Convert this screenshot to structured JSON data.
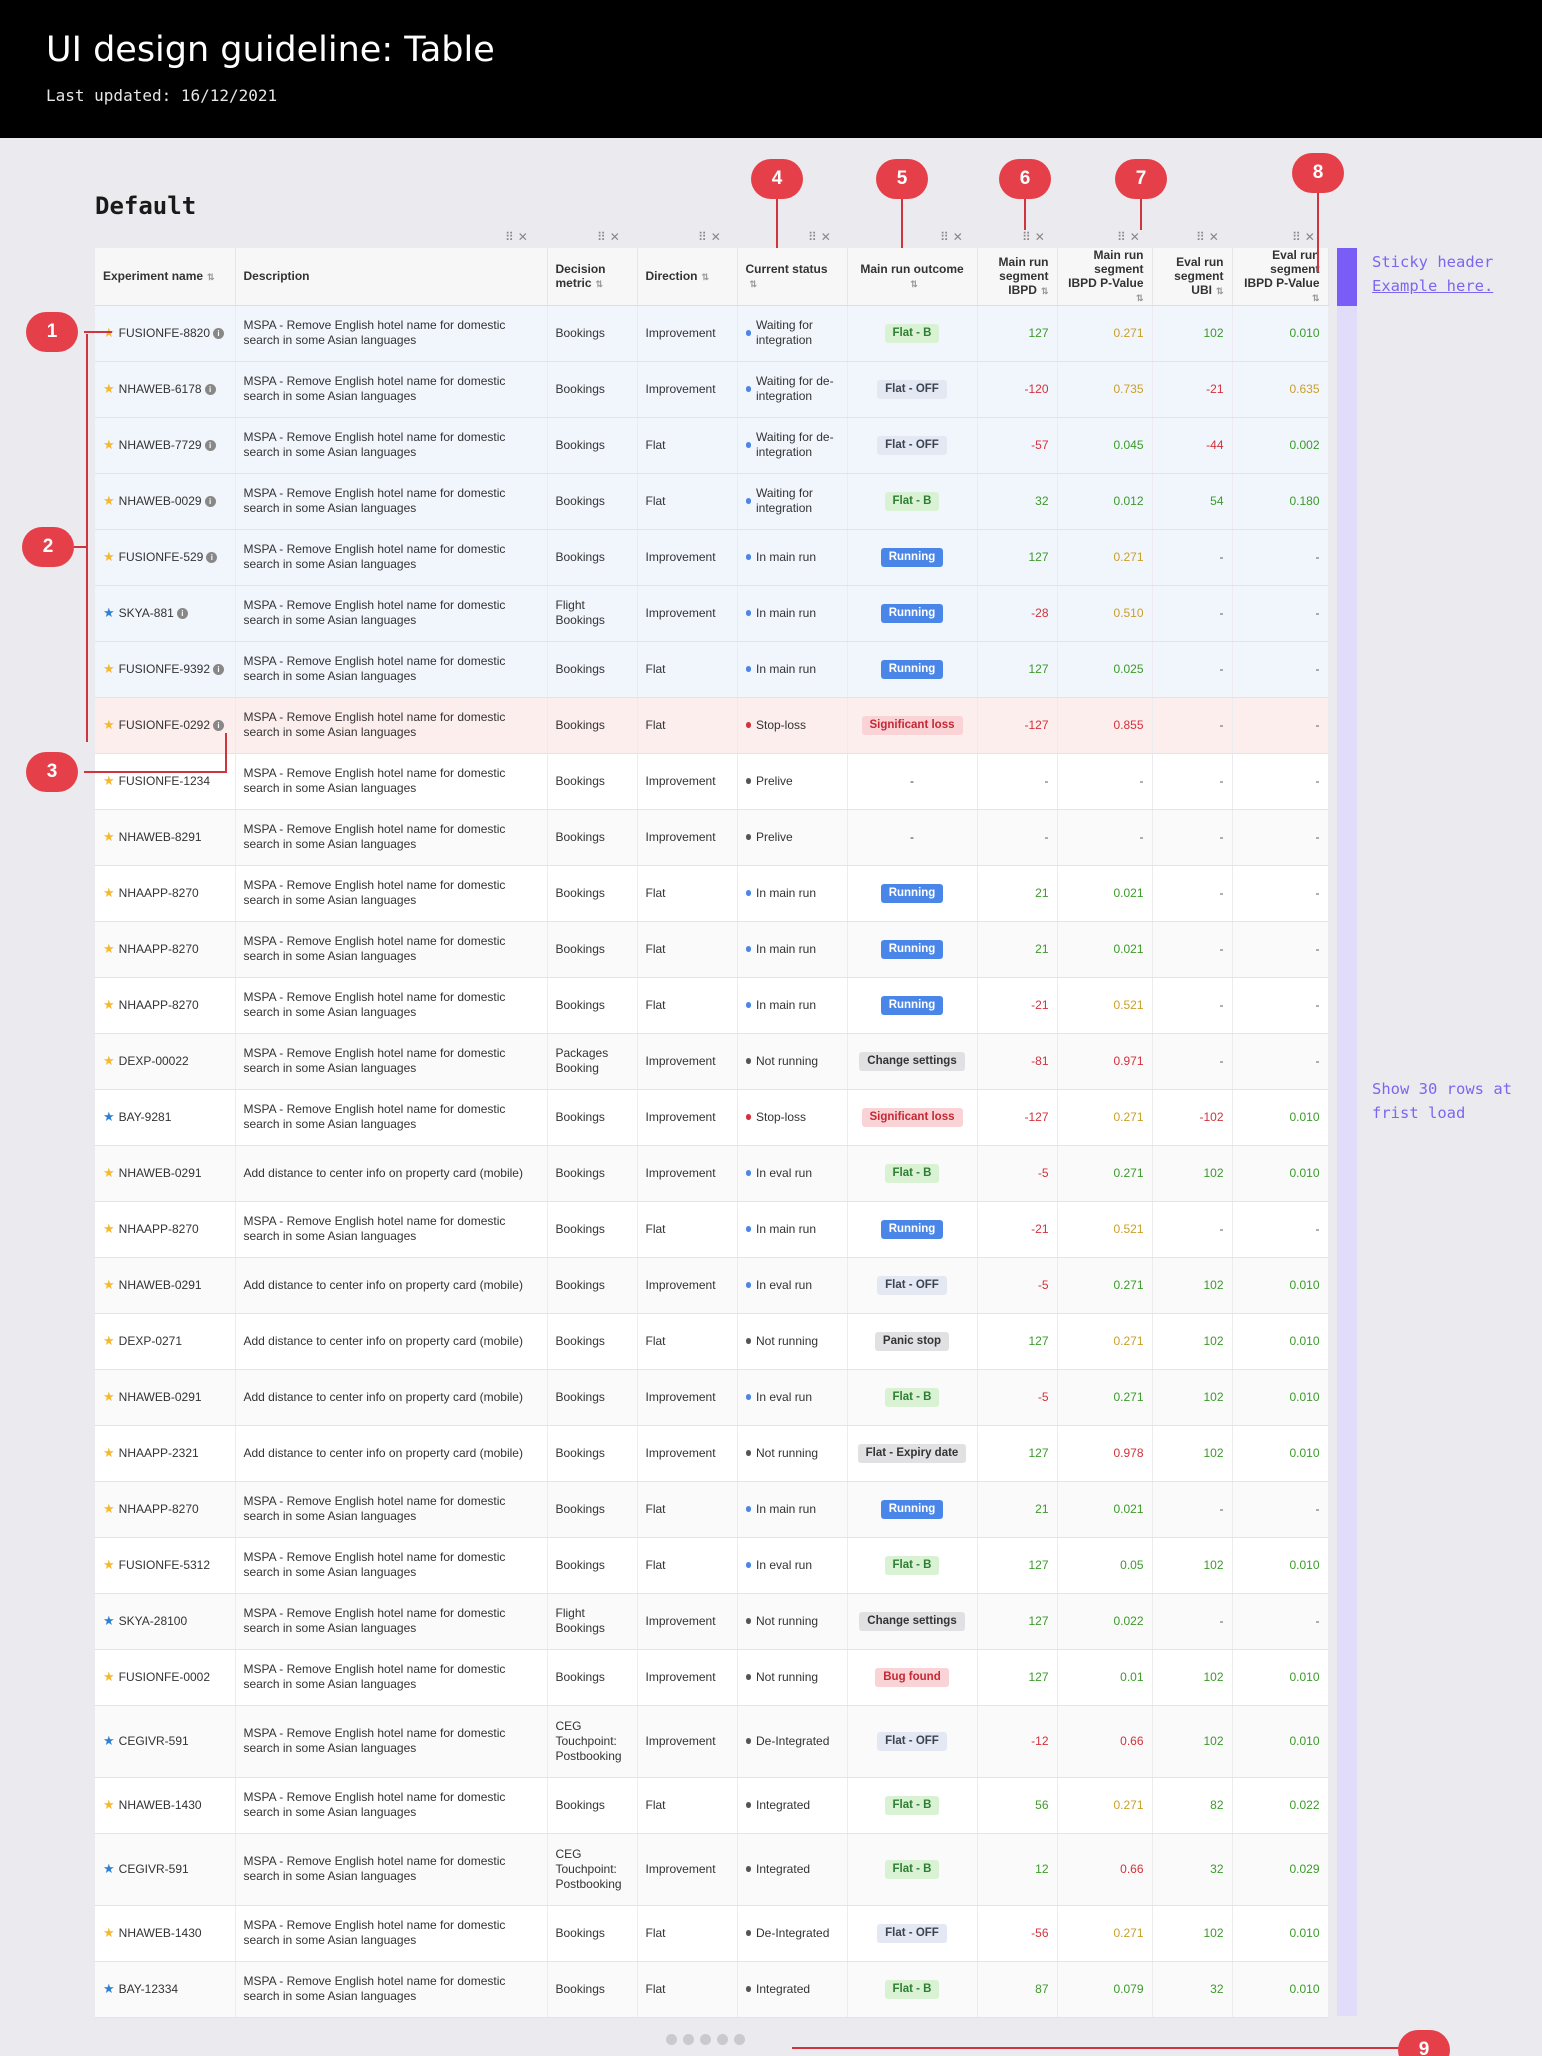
{
  "header": {
    "title": "UI design guideline: Table",
    "subtitle": "Last updated: 16/12/2021"
  },
  "section_title": "Default",
  "columns": [
    "Experiment name",
    "Description",
    "Decision metric",
    "Direction",
    "Current status",
    "Main run outcome",
    "Main run segment IBPD",
    "Main run segment IBPD P-Value",
    "Eval run segment UBI",
    "Eval run segment IBPD P-Value"
  ],
  "icons": {
    "star": "star-icon",
    "info": "info-icon",
    "sort": "sort-icon",
    "drag": "drag-handle-icon",
    "close": "close-icon"
  },
  "column_controls": {
    "drag": "⠿",
    "close": "✕"
  },
  "colors": {
    "star_yellow": "#f5b82e",
    "star_blue": "#2f7fd1",
    "positive": "#3c9a2a",
    "negative": "#d3313b",
    "neutral_amber": "#c99f2a",
    "dot_blue": "#4a86e8",
    "dot_red": "#d3313b",
    "dot_gray": "#555555",
    "accent": "#7a5cf6",
    "marker": "#e5404a"
  },
  "badge_styles": {
    "Flat - B": {
      "bg": "#d9f2d4",
      "fg": "#2e7d32"
    },
    "Flat - OFF": {
      "bg": "#e3e8f2",
      "fg": "#3b4352"
    },
    "Running": {
      "bg": "#4a86e8",
      "fg": "#ffffff"
    },
    "Significant loss": {
      "bg": "#f9d3d5",
      "fg": "#c62834"
    },
    "Change settings": {
      "bg": "#e1e1e4",
      "fg": "#333333"
    },
    "Panic stop": {
      "bg": "#e1e1e4",
      "fg": "#333333"
    },
    "Flat - Expiry date": {
      "bg": "#e1e1e4",
      "fg": "#333333"
    },
    "Bug found": {
      "bg": "#f9d3d5",
      "fg": "#c62834"
    }
  },
  "rows": [
    {
      "name": "FUSIONFE-8820",
      "star": "yellow",
      "info": true,
      "desc": "MSPA - Remove English hotel name for domestic search in some Asian languages",
      "metric": "Bookings",
      "direction": "Improvement",
      "status": "Waiting for integration",
      "dot": "blue",
      "outcome": "Flat - B",
      "ibpd": "127",
      "ibpd_c": "positive",
      "pval": "0.271",
      "pval_c": "neutral_amber",
      "ubi": "102",
      "ubi_c": "positive",
      "epval": "0.010",
      "epval_c": "positive",
      "bg": "band"
    },
    {
      "name": "NHAWEB-6178",
      "star": "yellow",
      "info": true,
      "desc": "MSPA - Remove English hotel name for domestic search in some Asian languages",
      "metric": "Bookings",
      "direction": "Improvement",
      "status": "Waiting for de-integration",
      "dot": "blue",
      "outcome": "Flat - OFF",
      "ibpd": "-120",
      "ibpd_c": "negative",
      "pval": "0.735",
      "pval_c": "neutral_amber",
      "ubi": "-21",
      "ubi_c": "negative",
      "epval": "0.635",
      "epval_c": "neutral_amber",
      "bg": "band"
    },
    {
      "name": "NHAWEB-7729",
      "star": "yellow",
      "info": true,
      "desc": "MSPA - Remove English hotel name for domestic search in some Asian languages",
      "metric": "Bookings",
      "direction": "Flat",
      "status": "Waiting for de-integration",
      "dot": "blue",
      "outcome": "Flat - OFF",
      "ibpd": "-57",
      "ibpd_c": "negative",
      "pval": "0.045",
      "pval_c": "positive",
      "ubi": "-44",
      "ubi_c": "negative",
      "epval": "0.002",
      "epval_c": "positive",
      "bg": "band"
    },
    {
      "name": "NHAWEB-0029",
      "star": "yellow",
      "info": true,
      "desc": "MSPA - Remove English hotel name for domestic search in some Asian languages",
      "metric": "Bookings",
      "direction": "Flat",
      "status": "Waiting for integration",
      "dot": "blue",
      "outcome": "Flat - B",
      "ibpd": "32",
      "ibpd_c": "positive",
      "pval": "0.012",
      "pval_c": "positive",
      "ubi": "54",
      "ubi_c": "positive",
      "epval": "0.180",
      "epval_c": "positive",
      "bg": "band"
    },
    {
      "name": "FUSIONFE-529",
      "star": "yellow",
      "info": true,
      "desc": "MSPA - Remove English hotel name for domestic search in some Asian languages",
      "metric": "Bookings",
      "direction": "Improvement",
      "status": "In main run",
      "dot": "blue",
      "outcome": "Running",
      "ibpd": "127",
      "ibpd_c": "positive",
      "pval": "0.271",
      "pval_c": "neutral_amber",
      "ubi": "-",
      "ubi_c": "",
      "epval": "-",
      "epval_c": "",
      "bg": "band"
    },
    {
      "name": "SKYA-881",
      "star": "blue",
      "info": true,
      "desc": "MSPA - Remove English hotel name for domestic search in some Asian languages",
      "metric": "Flight Bookings",
      "direction": "Improvement",
      "status": "In main run",
      "dot": "blue",
      "outcome": "Running",
      "ibpd": "-28",
      "ibpd_c": "negative",
      "pval": "0.510",
      "pval_c": "neutral_amber",
      "ubi": "-",
      "ubi_c": "",
      "epval": "-",
      "epval_c": "",
      "bg": "band"
    },
    {
      "name": "FUSIONFE-9392",
      "star": "yellow",
      "info": true,
      "desc": "MSPA - Remove English hotel name for domestic search in some Asian languages",
      "metric": "Bookings",
      "direction": "Flat",
      "status": "In main run",
      "dot": "blue",
      "outcome": "Running",
      "ibpd": "127",
      "ibpd_c": "positive",
      "pval": "0.025",
      "pval_c": "positive",
      "ubi": "-",
      "ubi_c": "",
      "epval": "-",
      "epval_c": "",
      "bg": "band"
    },
    {
      "name": "FUSIONFE-0292",
      "star": "yellow",
      "info": true,
      "desc": "MSPA - Remove English hotel name for domestic search in some Asian languages",
      "metric": "Bookings",
      "direction": "Flat",
      "status": "Stop-loss",
      "dot": "red",
      "outcome": "Significant loss",
      "ibpd": "-127",
      "ibpd_c": "negative",
      "pval": "0.855",
      "pval_c": "negative",
      "ubi": "-",
      "ubi_c": "",
      "epval": "-",
      "epval_c": "",
      "bg": "loss"
    },
    {
      "name": "FUSIONFE-1234",
      "star": "yellow",
      "info": false,
      "desc": "MSPA - Remove English hotel name for domestic search in some Asian languages",
      "metric": "Bookings",
      "direction": "Improvement",
      "status": "Prelive",
      "dot": "gray",
      "outcome": "-",
      "ibpd": "-",
      "ibpd_c": "",
      "pval": "-",
      "pval_c": "",
      "ubi": "-",
      "ubi_c": "",
      "epval": "-",
      "epval_c": "",
      "bg": ""
    },
    {
      "name": "NHAWEB-8291",
      "star": "yellow",
      "info": false,
      "desc": "MSPA - Remove English hotel name for domestic search in some Asian languages",
      "metric": "Bookings",
      "direction": "Improvement",
      "status": "Prelive",
      "dot": "gray",
      "outcome": "-",
      "ibpd": "-",
      "ibpd_c": "",
      "pval": "-",
      "pval_c": "",
      "ubi": "-",
      "ubi_c": "",
      "epval": "-",
      "epval_c": "",
      "bg": "alt"
    },
    {
      "name": "NHAAPP-8270",
      "star": "yellow",
      "info": false,
      "desc": "MSPA - Remove English hotel name for domestic search in some Asian languages",
      "metric": "Bookings",
      "direction": "Flat",
      "status": "In main run",
      "dot": "blue",
      "outcome": "Running",
      "ibpd": "21",
      "ibpd_c": "positive",
      "pval": "0.021",
      "pval_c": "positive",
      "ubi": "-",
      "ubi_c": "",
      "epval": "-",
      "epval_c": "",
      "bg": ""
    },
    {
      "name": "NHAAPP-8270",
      "star": "yellow",
      "info": false,
      "desc": "MSPA - Remove English hotel name for domestic search in some Asian languages",
      "metric": "Bookings",
      "direction": "Flat",
      "status": "In main run",
      "dot": "blue",
      "outcome": "Running",
      "ibpd": "21",
      "ibpd_c": "positive",
      "pval": "0.021",
      "pval_c": "positive",
      "ubi": "-",
      "ubi_c": "",
      "epval": "-",
      "epval_c": "",
      "bg": "alt"
    },
    {
      "name": "NHAAPP-8270",
      "star": "yellow",
      "info": false,
      "desc": "MSPA - Remove English hotel name for domestic search in some Asian languages",
      "metric": "Bookings",
      "direction": "Flat",
      "status": "In main run",
      "dot": "blue",
      "outcome": "Running",
      "ibpd": "-21",
      "ibpd_c": "negative",
      "pval": "0.521",
      "pval_c": "neutral_amber",
      "ubi": "-",
      "ubi_c": "",
      "epval": "-",
      "epval_c": "",
      "bg": ""
    },
    {
      "name": "DEXP-00022",
      "star": "yellow",
      "info": false,
      "desc": "MSPA - Remove English hotel name for domestic search in some Asian languages",
      "metric": "Packages Booking",
      "direction": "Improvement",
      "status": "Not running",
      "dot": "gray",
      "outcome": "Change settings",
      "ibpd": "-81",
      "ibpd_c": "negative",
      "pval": "0.971",
      "pval_c": "negative",
      "ubi": "-",
      "ubi_c": "",
      "epval": "-",
      "epval_c": "",
      "bg": "alt"
    },
    {
      "name": "BAY-9281",
      "star": "blue",
      "info": false,
      "desc": "MSPA - Remove English hotel name for domestic search in some Asian languages",
      "metric": "Bookings",
      "direction": "Improvement",
      "status": "Stop-loss",
      "dot": "red",
      "outcome": "Significant loss",
      "ibpd": "-127",
      "ibpd_c": "negative",
      "pval": "0.271",
      "pval_c": "neutral_amber",
      "ubi": "-102",
      "ubi_c": "negative",
      "epval": "0.010",
      "epval_c": "positive",
      "bg": ""
    },
    {
      "name": "NHAWEB-0291",
      "star": "yellow",
      "info": false,
      "desc": "Add distance to center info on property card (mobile)",
      "metric": "Bookings",
      "direction": "Improvement",
      "status": "In eval run",
      "dot": "blue",
      "outcome": "Flat - B",
      "ibpd": "-5",
      "ibpd_c": "negative",
      "pval": "0.271",
      "pval_c": "positive",
      "ubi": "102",
      "ubi_c": "positive",
      "epval": "0.010",
      "epval_c": "positive",
      "bg": "alt"
    },
    {
      "name": "NHAAPP-8270",
      "star": "yellow",
      "info": false,
      "desc": "MSPA - Remove English hotel name for domestic search in some Asian languages",
      "metric": "Bookings",
      "direction": "Flat",
      "status": "In main run",
      "dot": "blue",
      "outcome": "Running",
      "ibpd": "-21",
      "ibpd_c": "negative",
      "pval": "0.521",
      "pval_c": "neutral_amber",
      "ubi": "-",
      "ubi_c": "",
      "epval": "-",
      "epval_c": "",
      "bg": ""
    },
    {
      "name": "NHAWEB-0291",
      "star": "yellow",
      "info": false,
      "desc": "Add distance to center info on property card (mobile)",
      "metric": "Bookings",
      "direction": "Improvement",
      "status": "In eval run",
      "dot": "blue",
      "outcome": "Flat - OFF",
      "ibpd": "-5",
      "ibpd_c": "negative",
      "pval": "0.271",
      "pval_c": "positive",
      "ubi": "102",
      "ubi_c": "positive",
      "epval": "0.010",
      "epval_c": "positive",
      "bg": "alt"
    },
    {
      "name": "DEXP-0271",
      "star": "yellow",
      "info": false,
      "desc": "Add distance to center info on property card (mobile)",
      "metric": "Bookings",
      "direction": "Flat",
      "status": "Not running",
      "dot": "gray",
      "outcome": "Panic stop",
      "ibpd": "127",
      "ibpd_c": "positive",
      "pval": "0.271",
      "pval_c": "neutral_amber",
      "ubi": "102",
      "ubi_c": "positive",
      "epval": "0.010",
      "epval_c": "positive",
      "bg": ""
    },
    {
      "name": "NHAWEB-0291",
      "star": "yellow",
      "info": false,
      "desc": "Add distance to center info on property card (mobile)",
      "metric": "Bookings",
      "direction": "Improvement",
      "status": "In eval run",
      "dot": "blue",
      "outcome": "Flat - B",
      "ibpd": "-5",
      "ibpd_c": "negative",
      "pval": "0.271",
      "pval_c": "positive",
      "ubi": "102",
      "ubi_c": "positive",
      "epval": "0.010",
      "epval_c": "positive",
      "bg": "alt"
    },
    {
      "name": "NHAAPP-2321",
      "star": "yellow",
      "info": false,
      "desc": "Add distance to center info on property card (mobile)",
      "metric": "Bookings",
      "direction": "Improvement",
      "status": "Not running",
      "dot": "gray",
      "outcome": "Flat - Expiry date",
      "ibpd": "127",
      "ibpd_c": "positive",
      "pval": "0.978",
      "pval_c": "negative",
      "ubi": "102",
      "ubi_c": "positive",
      "epval": "0.010",
      "epval_c": "positive",
      "bg": ""
    },
    {
      "name": "NHAAPP-8270",
      "star": "yellow",
      "info": false,
      "desc": "MSPA - Remove English hotel name for domestic search in some Asian languages",
      "metric": "Bookings",
      "direction": "Flat",
      "status": "In main run",
      "dot": "blue",
      "outcome": "Running",
      "ibpd": "21",
      "ibpd_c": "positive",
      "pval": "0.021",
      "pval_c": "positive",
      "ubi": "-",
      "ubi_c": "",
      "epval": "-",
      "epval_c": "",
      "bg": "alt"
    },
    {
      "name": "FUSIONFE-5312",
      "star": "yellow",
      "info": false,
      "desc": "MSPA - Remove English hotel name for domestic search in some Asian languages",
      "metric": "Bookings",
      "direction": "Flat",
      "status": "In eval run",
      "dot": "blue",
      "outcome": "Flat - B",
      "ibpd": "127",
      "ibpd_c": "positive",
      "pval": "0.05",
      "pval_c": "positive",
      "ubi": "102",
      "ubi_c": "positive",
      "epval": "0.010",
      "epval_c": "positive",
      "bg": ""
    },
    {
      "name": "SKYA-28100",
      "star": "blue",
      "info": false,
      "desc": "MSPA - Remove English hotel name for domestic search in some Asian languages",
      "metric": "Flight Bookings",
      "direction": "Improvement",
      "status": "Not running",
      "dot": "gray",
      "outcome": "Change settings",
      "ibpd": "127",
      "ibpd_c": "positive",
      "pval": "0.022",
      "pval_c": "positive",
      "ubi": "-",
      "ubi_c": "",
      "epval": "-",
      "epval_c": "",
      "bg": "alt"
    },
    {
      "name": "FUSIONFE-0002",
      "star": "yellow",
      "info": false,
      "desc": "MSPA - Remove English hotel name for domestic search in some Asian languages",
      "metric": "Bookings",
      "direction": "Improvement",
      "status": "Not running",
      "dot": "gray",
      "outcome": "Bug found",
      "ibpd": "127",
      "ibpd_c": "positive",
      "pval": "0.01",
      "pval_c": "positive",
      "ubi": "102",
      "ubi_c": "positive",
      "epval": "0.010",
      "epval_c": "positive",
      "bg": ""
    },
    {
      "name": "CEGIVR-591",
      "star": "blue",
      "info": false,
      "desc": "MSPA - Remove English hotel name for domestic search in some Asian languages",
      "metric": "CEG Touchpoint: Postbooking",
      "direction": "Improvement",
      "status": "De-Integrated",
      "dot": "gray",
      "outcome": "Flat - OFF",
      "ibpd": "-12",
      "ibpd_c": "negative",
      "pval": "0.66",
      "pval_c": "negative",
      "ubi": "102",
      "ubi_c": "positive",
      "epval": "0.010",
      "epval_c": "positive",
      "bg": "alt",
      "tall": true
    },
    {
      "name": "NHAWEB-1430",
      "star": "yellow",
      "info": false,
      "desc": "MSPA - Remove English hotel name for domestic search in some Asian languages",
      "metric": "Bookings",
      "direction": "Flat",
      "status": "Integrated",
      "dot": "gray",
      "outcome": "Flat - B",
      "ibpd": "56",
      "ibpd_c": "positive",
      "pval": "0.271",
      "pval_c": "neutral_amber",
      "ubi": "82",
      "ubi_c": "positive",
      "epval": "0.022",
      "epval_c": "positive",
      "bg": ""
    },
    {
      "name": "CEGIVR-591",
      "star": "blue",
      "info": false,
      "desc": "MSPA - Remove English hotel name for domestic search in some Asian languages",
      "metric": "CEG Touchpoint: Postbooking",
      "direction": "Improvement",
      "status": "Integrated",
      "dot": "gray",
      "outcome": "Flat - B",
      "ibpd": "12",
      "ibpd_c": "positive",
      "pval": "0.66",
      "pval_c": "negative",
      "ubi": "32",
      "ubi_c": "positive",
      "epval": "0.029",
      "epval_c": "positive",
      "bg": "alt",
      "tall": true
    },
    {
      "name": "NHAWEB-1430",
      "star": "yellow",
      "info": false,
      "desc": "MSPA - Remove English hotel name for domestic search in some Asian languages",
      "metric": "Bookings",
      "direction": "Flat",
      "status": "De-Integrated",
      "dot": "gray",
      "outcome": "Flat - OFF",
      "ibpd": "-56",
      "ibpd_c": "negative",
      "pval": "0.271",
      "pval_c": "neutral_amber",
      "ubi": "102",
      "ubi_c": "positive",
      "epval": "0.010",
      "epval_c": "positive",
      "bg": ""
    },
    {
      "name": "BAY-12334",
      "star": "blue",
      "info": false,
      "desc": "MSPA - Remove English hotel name for domestic search in some Asian languages",
      "metric": "Bookings",
      "direction": "Flat",
      "status": "Integrated",
      "dot": "gray",
      "outcome": "Flat - B",
      "ibpd": "87",
      "ibpd_c": "positive",
      "pval": "0.079",
      "pval_c": "positive",
      "ubi": "32",
      "ubi_c": "positive",
      "epval": "0.010",
      "epval_c": "positive",
      "bg": "alt"
    }
  ],
  "annotations": {
    "markers": [
      "1",
      "2",
      "3",
      "4",
      "5",
      "6",
      "7",
      "8",
      "9"
    ]
  },
  "notes": {
    "sticky_line1": "Sticky header",
    "sticky_line2": "Example here.",
    "rows_line1": "Show 30 rows at",
    "rows_line2": "frist load"
  }
}
